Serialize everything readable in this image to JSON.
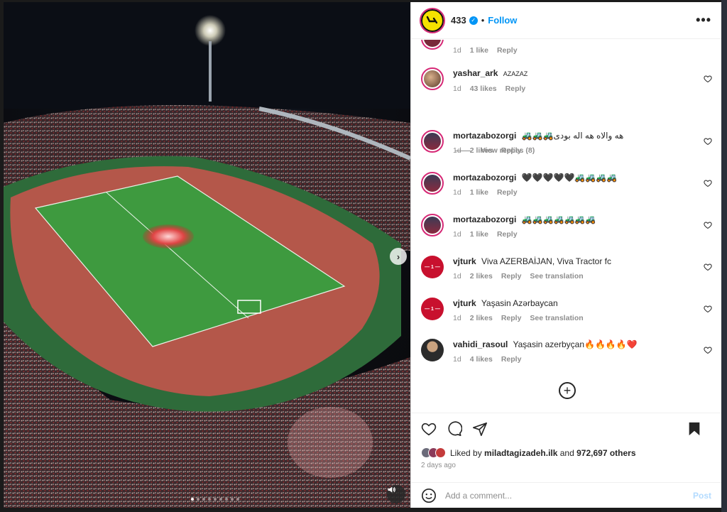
{
  "header": {
    "username": "433",
    "separator": "•",
    "follow_label": "Follow",
    "more_label": "•••"
  },
  "comments": [
    {
      "user": "",
      "text": "",
      "time": "1d",
      "likes": "1 like",
      "reply": "Reply",
      "translate": ""
    },
    {
      "user": "yashar_ark",
      "text": "AZAZAZ",
      "time": "1d",
      "likes": "43 likes",
      "reply": "Reply",
      "translate": ""
    },
    {
      "user": "mortazabozorgi",
      "text": "🚜🚜🚜هه والاه هه اله بودی",
      "time": "1d",
      "likes": "2 likes",
      "reply": "Reply",
      "translate": ""
    },
    {
      "user": "mortazabozorgi",
      "text": "🖤🖤🖤🖤🖤🚜🚜🚜🚜",
      "time": "1d",
      "likes": "1 like",
      "reply": "Reply",
      "translate": ""
    },
    {
      "user": "mortazabozorgi",
      "text": "🚜🚜🚜🚜🚜🚜🚜",
      "time": "1d",
      "likes": "1 like",
      "reply": "Reply",
      "translate": ""
    },
    {
      "user": "vjturk",
      "text": "Viva AZERBAİJAN, Viva Tractor fc",
      "time": "1d",
      "likes": "2 likes",
      "reply": "Reply",
      "translate": "See translation"
    },
    {
      "user": "vjturk",
      "text": "Yaşasin Azərbaycan",
      "time": "1d",
      "likes": "2 likes",
      "reply": "Reply",
      "translate": "See translation"
    },
    {
      "user": "vahidi_rasoul",
      "text": "Yaşasin azerbyçan🔥🔥🔥🔥❤️",
      "time": "1d",
      "likes": "4 likes",
      "reply": "Reply",
      "translate": ""
    }
  ],
  "view_replies": "View replies (8)",
  "likes_summary": {
    "prefix": "Liked by",
    "user": "miladtagizadeh.ilk",
    "middle": "and",
    "count": "972,697 others"
  },
  "posted_ago": "2 days ago",
  "add_comment": {
    "placeholder": "Add a comment...",
    "post_label": "Post"
  },
  "media": {
    "carousel_total": 9,
    "carousel_active": 1
  },
  "colors": {
    "accent": "#0095f6",
    "brand_yellow": "#f5e100",
    "story_ring": "#d62976"
  }
}
